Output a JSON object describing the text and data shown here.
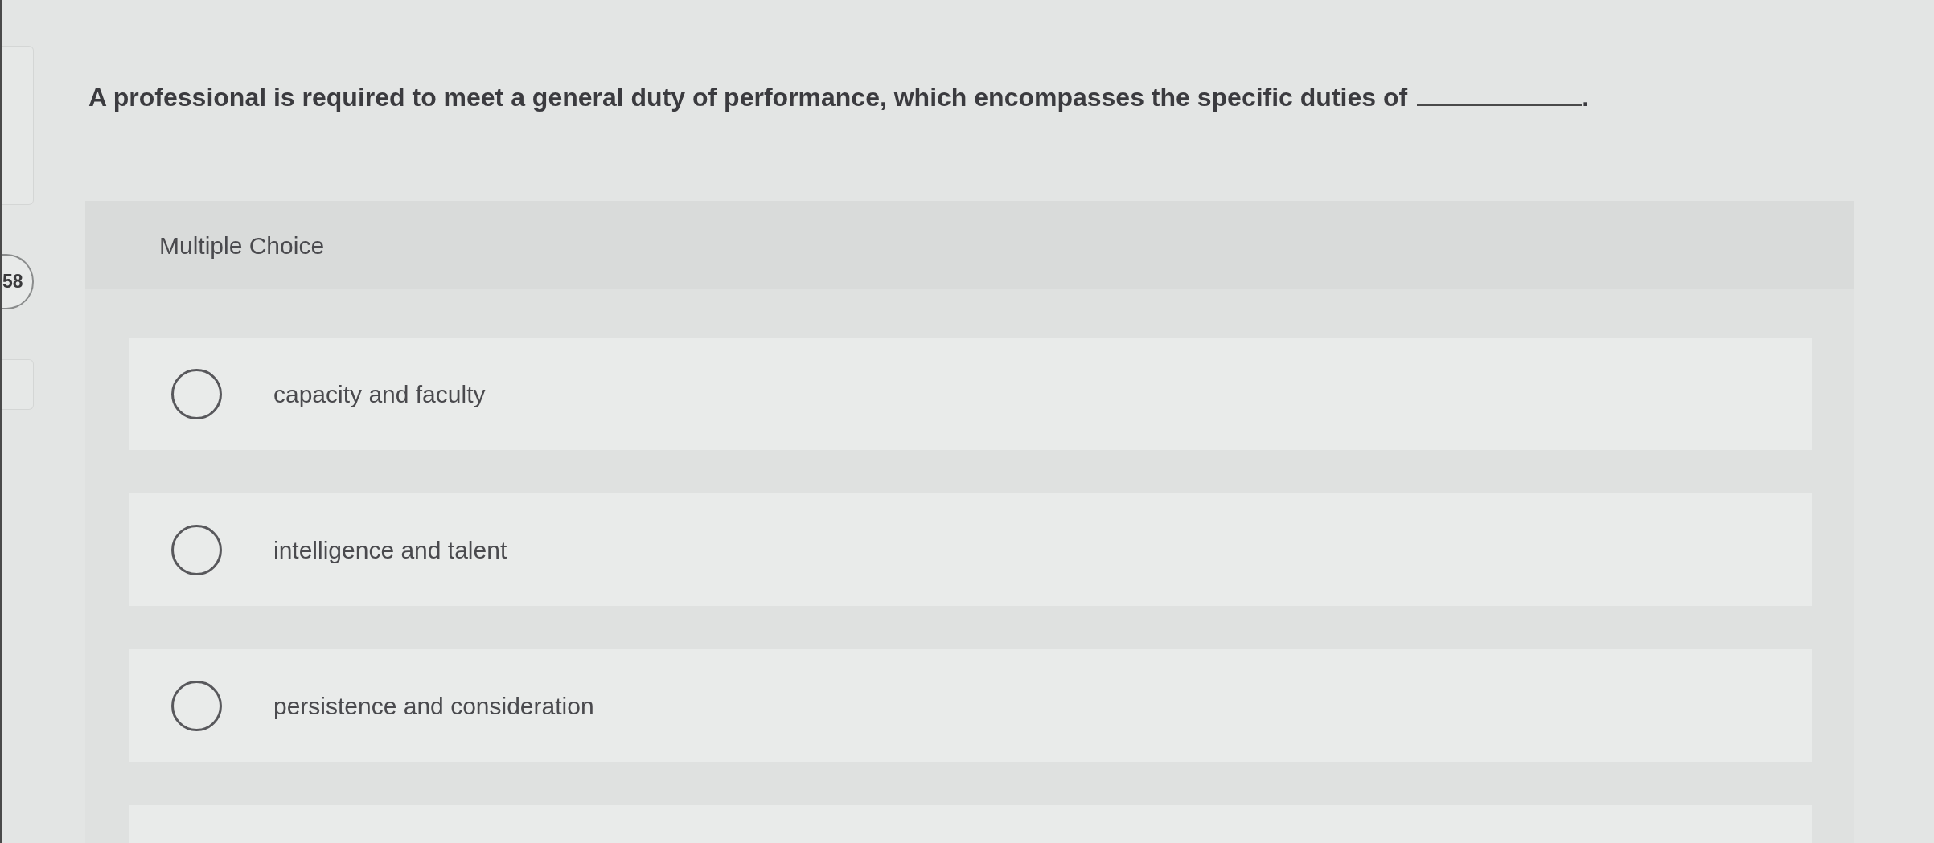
{
  "question_number": "58",
  "question": {
    "text": "A professional is required to meet a general duty of performance, which encompasses the specific duties of",
    "after_blank": "."
  },
  "answer_type": "Multiple Choice",
  "options": [
    {
      "label": "capacity and faculty",
      "selected": false
    },
    {
      "label": "intelligence and talent",
      "selected": false
    },
    {
      "label": "persistence and consideration",
      "selected": false
    }
  ]
}
